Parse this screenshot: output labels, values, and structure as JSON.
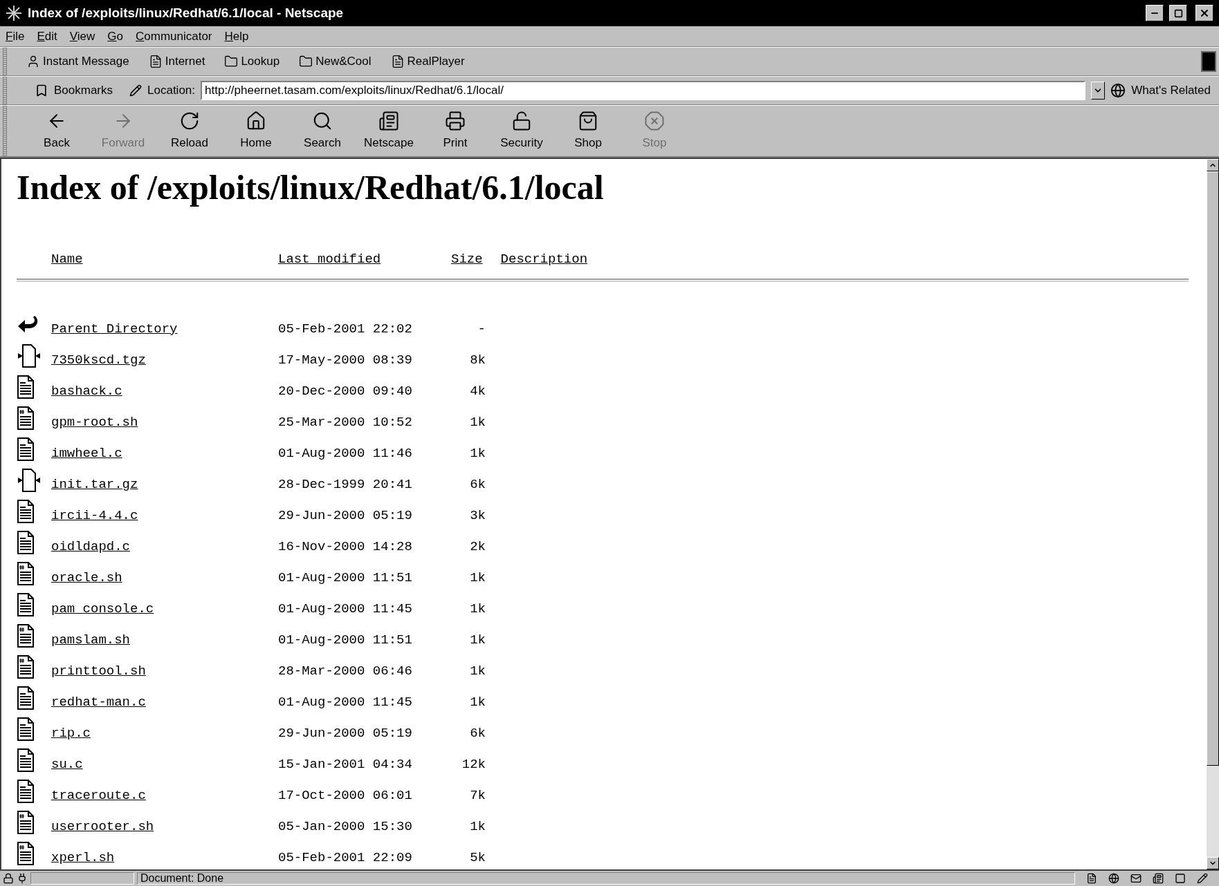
{
  "window": {
    "title": "Index of /exploits/linux/Redhat/6.1/local - Netscape"
  },
  "menu": [
    "File",
    "Edit",
    "View",
    "Go",
    "Communicator",
    "Help"
  ],
  "personal_toolbar": [
    {
      "label": "Instant Message",
      "kind": "person"
    },
    {
      "label": "Internet",
      "kind": "page"
    },
    {
      "label": "Lookup",
      "kind": "folder"
    },
    {
      "label": "New&Cool",
      "kind": "folder"
    },
    {
      "label": "RealPlayer",
      "kind": "page"
    }
  ],
  "location_bar": {
    "bookmarks": "Bookmarks",
    "label": "Location:",
    "value": "http://pheernet.tasam.com/exploits/linux/Redhat/6.1/local/",
    "related": "What's Related"
  },
  "nav_buttons": [
    {
      "label": "Back",
      "kind": "back",
      "disabled": false
    },
    {
      "label": "Forward",
      "kind": "forward",
      "disabled": true
    },
    {
      "label": "Reload",
      "kind": "reload",
      "disabled": false
    },
    {
      "label": "Home",
      "kind": "home",
      "disabled": false
    },
    {
      "label": "Search",
      "kind": "search",
      "disabled": false
    },
    {
      "label": "Netscape",
      "kind": "portal",
      "disabled": false
    },
    {
      "label": "Print",
      "kind": "print",
      "disabled": false
    },
    {
      "label": "Security",
      "kind": "security",
      "disabled": false
    },
    {
      "label": "Shop",
      "kind": "shop",
      "disabled": false
    },
    {
      "label": "Stop",
      "kind": "stop",
      "disabled": true
    }
  ],
  "page": {
    "heading": "Index of /exploits/linux/Redhat/6.1/local",
    "columns": [
      "Name",
      "Last modified",
      "Size",
      "Description"
    ],
    "rows": [
      {
        "kind": "parent",
        "name": "Parent Directory",
        "modified": "05-Feb-2001 22:02",
        "size": "-"
      },
      {
        "kind": "archive",
        "name": "7350kscd.tgz",
        "modified": "17-May-2000 08:39",
        "size": "8k"
      },
      {
        "kind": "text",
        "name": "bashack.c",
        "modified": "20-Dec-2000 09:40",
        "size": "4k"
      },
      {
        "kind": "script",
        "name": "gpm-root.sh",
        "modified": "25-Mar-2000 10:52",
        "size": "1k"
      },
      {
        "kind": "text",
        "name": "imwheel.c",
        "modified": "01-Aug-2000 11:46",
        "size": "1k"
      },
      {
        "kind": "archive",
        "name": "init.tar.gz",
        "modified": "28-Dec-1999 20:41",
        "size": "6k"
      },
      {
        "kind": "text",
        "name": "ircii-4.4.c",
        "modified": "29-Jun-2000 05:19",
        "size": "3k"
      },
      {
        "kind": "text",
        "name": "oidldapd.c",
        "modified": "16-Nov-2000 14:28",
        "size": "2k"
      },
      {
        "kind": "script",
        "name": "oracle.sh",
        "modified": "01-Aug-2000 11:51",
        "size": "1k"
      },
      {
        "kind": "text",
        "name": "pam_console.c",
        "modified": "01-Aug-2000 11:45",
        "size": "1k"
      },
      {
        "kind": "script",
        "name": "pamslam.sh",
        "modified": "01-Aug-2000 11:51",
        "size": "1k"
      },
      {
        "kind": "script",
        "name": "printtool.sh",
        "modified": "28-Mar-2000 06:46",
        "size": "1k"
      },
      {
        "kind": "text",
        "name": "redhat-man.c",
        "modified": "01-Aug-2000 11:45",
        "size": "1k"
      },
      {
        "kind": "text",
        "name": "rip.c",
        "modified": "29-Jun-2000 05:19",
        "size": "6k"
      },
      {
        "kind": "text",
        "name": "su.c",
        "modified": "15-Jan-2001 04:34",
        "size": "12k"
      },
      {
        "kind": "text",
        "name": "traceroute.c",
        "modified": "17-Oct-2000 06:01",
        "size": "7k"
      },
      {
        "kind": "script",
        "name": "userrooter.sh",
        "modified": "05-Jan-2000 15:30",
        "size": "1k"
      },
      {
        "kind": "script",
        "name": "xperl.sh",
        "modified": "05-Feb-2001 22:09",
        "size": "5k"
      }
    ]
  },
  "status_bar": {
    "text": "Document: Done"
  }
}
